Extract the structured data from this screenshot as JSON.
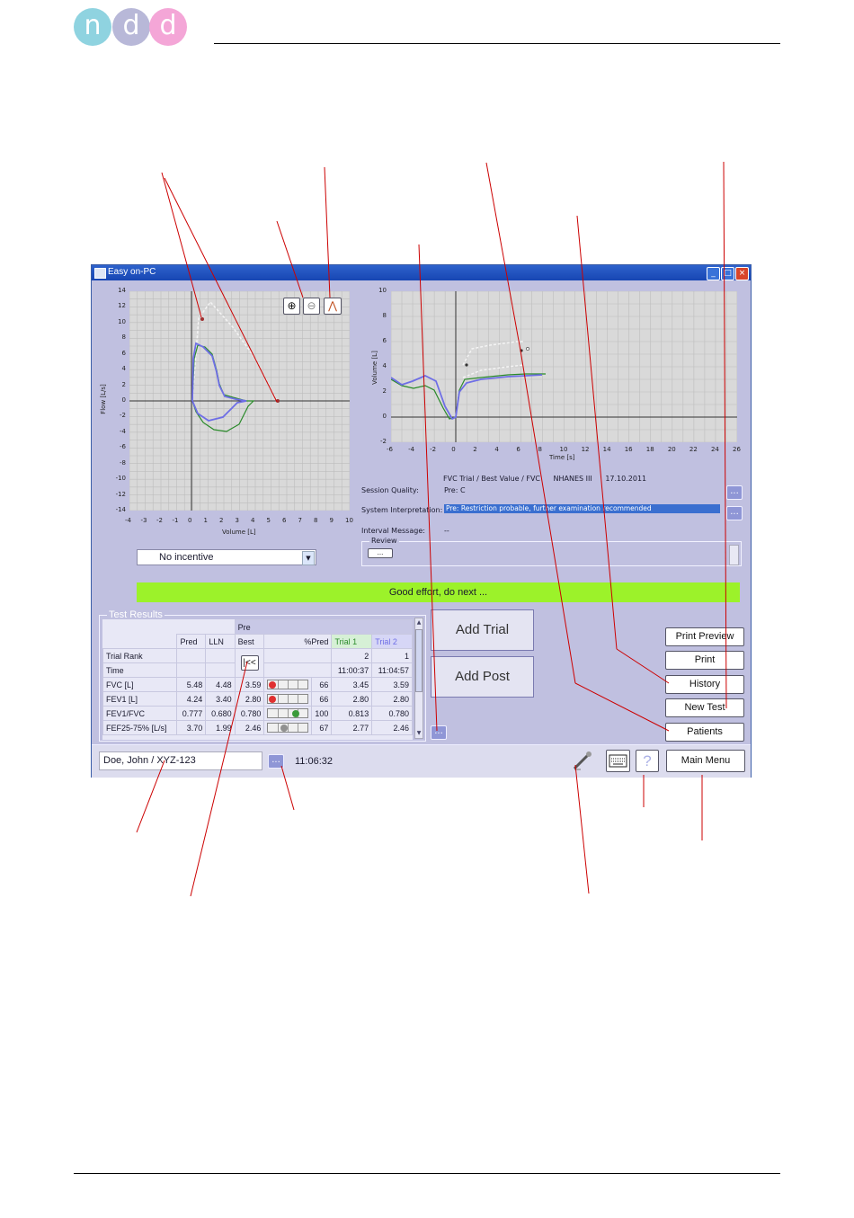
{
  "logo": {
    "letters": [
      "n",
      "d",
      "d"
    ],
    "colors": [
      "#8fd3e0",
      "#b8b8d8",
      "#f4a6d7"
    ]
  },
  "window": {
    "title": "Easy on-PC"
  },
  "flow_chart": {
    "y_ticks": [
      "14",
      "12",
      "10",
      "8",
      "6",
      "4",
      "2",
      "0",
      "-2",
      "-4",
      "-6",
      "-8",
      "-10",
      "-12",
      "-14"
    ],
    "x_ticks": [
      "-4",
      "-3",
      "-2",
      "-1",
      "0",
      "1",
      "2",
      "3",
      "4",
      "5",
      "6",
      "7",
      "8",
      "9",
      "10"
    ],
    "ylabel": "Flow [L/s]",
    "xlabel": "Volume [L]"
  },
  "volume_chart": {
    "y_ticks": [
      "10",
      "8",
      "6",
      "4",
      "2",
      "0",
      "-2"
    ],
    "x_ticks": [
      "-6",
      "-4",
      "-2",
      "0",
      "2",
      "4",
      "6",
      "8",
      "10",
      "12",
      "14",
      "16",
      "18",
      "20",
      "22",
      "24",
      "26"
    ],
    "ylabel": "Volume [L]",
    "xlabel": "Time [s]"
  },
  "info": {
    "header": "FVC Trial / Best Value / FVC",
    "norm": "NHANES III",
    "date": "17.10.2011",
    "session_quality_label": "Session Quality:",
    "session_quality_value": "Pre: C",
    "system_interp_label": "System Interpretation:",
    "system_interp_value": "Pre: Restriction probable, further examination recommended",
    "interval_label": "Interval Message:",
    "interval_value": "--",
    "review_label": "Review",
    "review_button": "..."
  },
  "incentive": {
    "selected": "No incentive"
  },
  "message_bar": "Good effort, do next ...",
  "results": {
    "group_label": "Test Results",
    "phase": "Pre",
    "columns": [
      "Pred",
      "LLN",
      "Best",
      "%Pred",
      "Trial 1",
      "Trial 2"
    ],
    "trial_rank_label": "Trial Rank",
    "trial_rank": [
      "2",
      "1"
    ],
    "time_label": "Time",
    "times": [
      "11:00:37",
      "11:04:57"
    ],
    "rows": [
      {
        "name": "FVC [L]",
        "pred": "5.48",
        "lln": "4.48",
        "best": "3.59",
        "pct": "66",
        "t1": "3.45",
        "t2": "3.59"
      },
      {
        "name": "FEV1 [L]",
        "pred": "4.24",
        "lln": "3.40",
        "best": "2.80",
        "pct": "66",
        "t1": "2.80",
        "t2": "2.80"
      },
      {
        "name": "FEV1/FVC",
        "pred": "0.777",
        "lln": "0.680",
        "best": "0.780",
        "pct": "100",
        "t1": "0.813",
        "t2": "0.780"
      },
      {
        "name": "FEF25-75% [L/s]",
        "pred": "3.70",
        "lln": "1.99",
        "best": "2.46",
        "pct": "67",
        "t1": "2.77",
        "t2": "2.46"
      }
    ]
  },
  "buttons": {
    "add_trial": "Add Trial",
    "add_post": "Add Post",
    "print_preview": "Print Preview",
    "print": "Print",
    "history": "History",
    "new_test": "New Test",
    "patients": "Patients",
    "main_menu": "Main Menu",
    "help": "?",
    "more": "..."
  },
  "status": {
    "patient": "Doe, John / XYZ-123",
    "clock": "11:06:32"
  },
  "colors": {
    "window_bg": "#c0c0e0",
    "message_bar": "#9cf22a",
    "trial1": "#2a8a2a",
    "trial2": "#6e6ee6",
    "annotation": "#cc0000"
  }
}
